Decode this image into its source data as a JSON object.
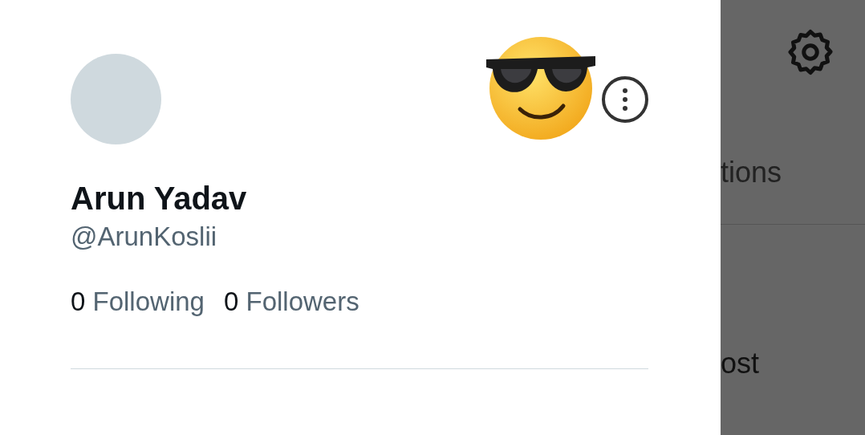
{
  "profile": {
    "name": "Arun Yadav",
    "handle": "@ArunKoslii"
  },
  "stats": [
    {
      "count": "0",
      "label": "Following"
    },
    {
      "count": "0",
      "label": "Followers"
    }
  ],
  "background_menu": {
    "items": [
      "tions",
      "ost"
    ]
  }
}
